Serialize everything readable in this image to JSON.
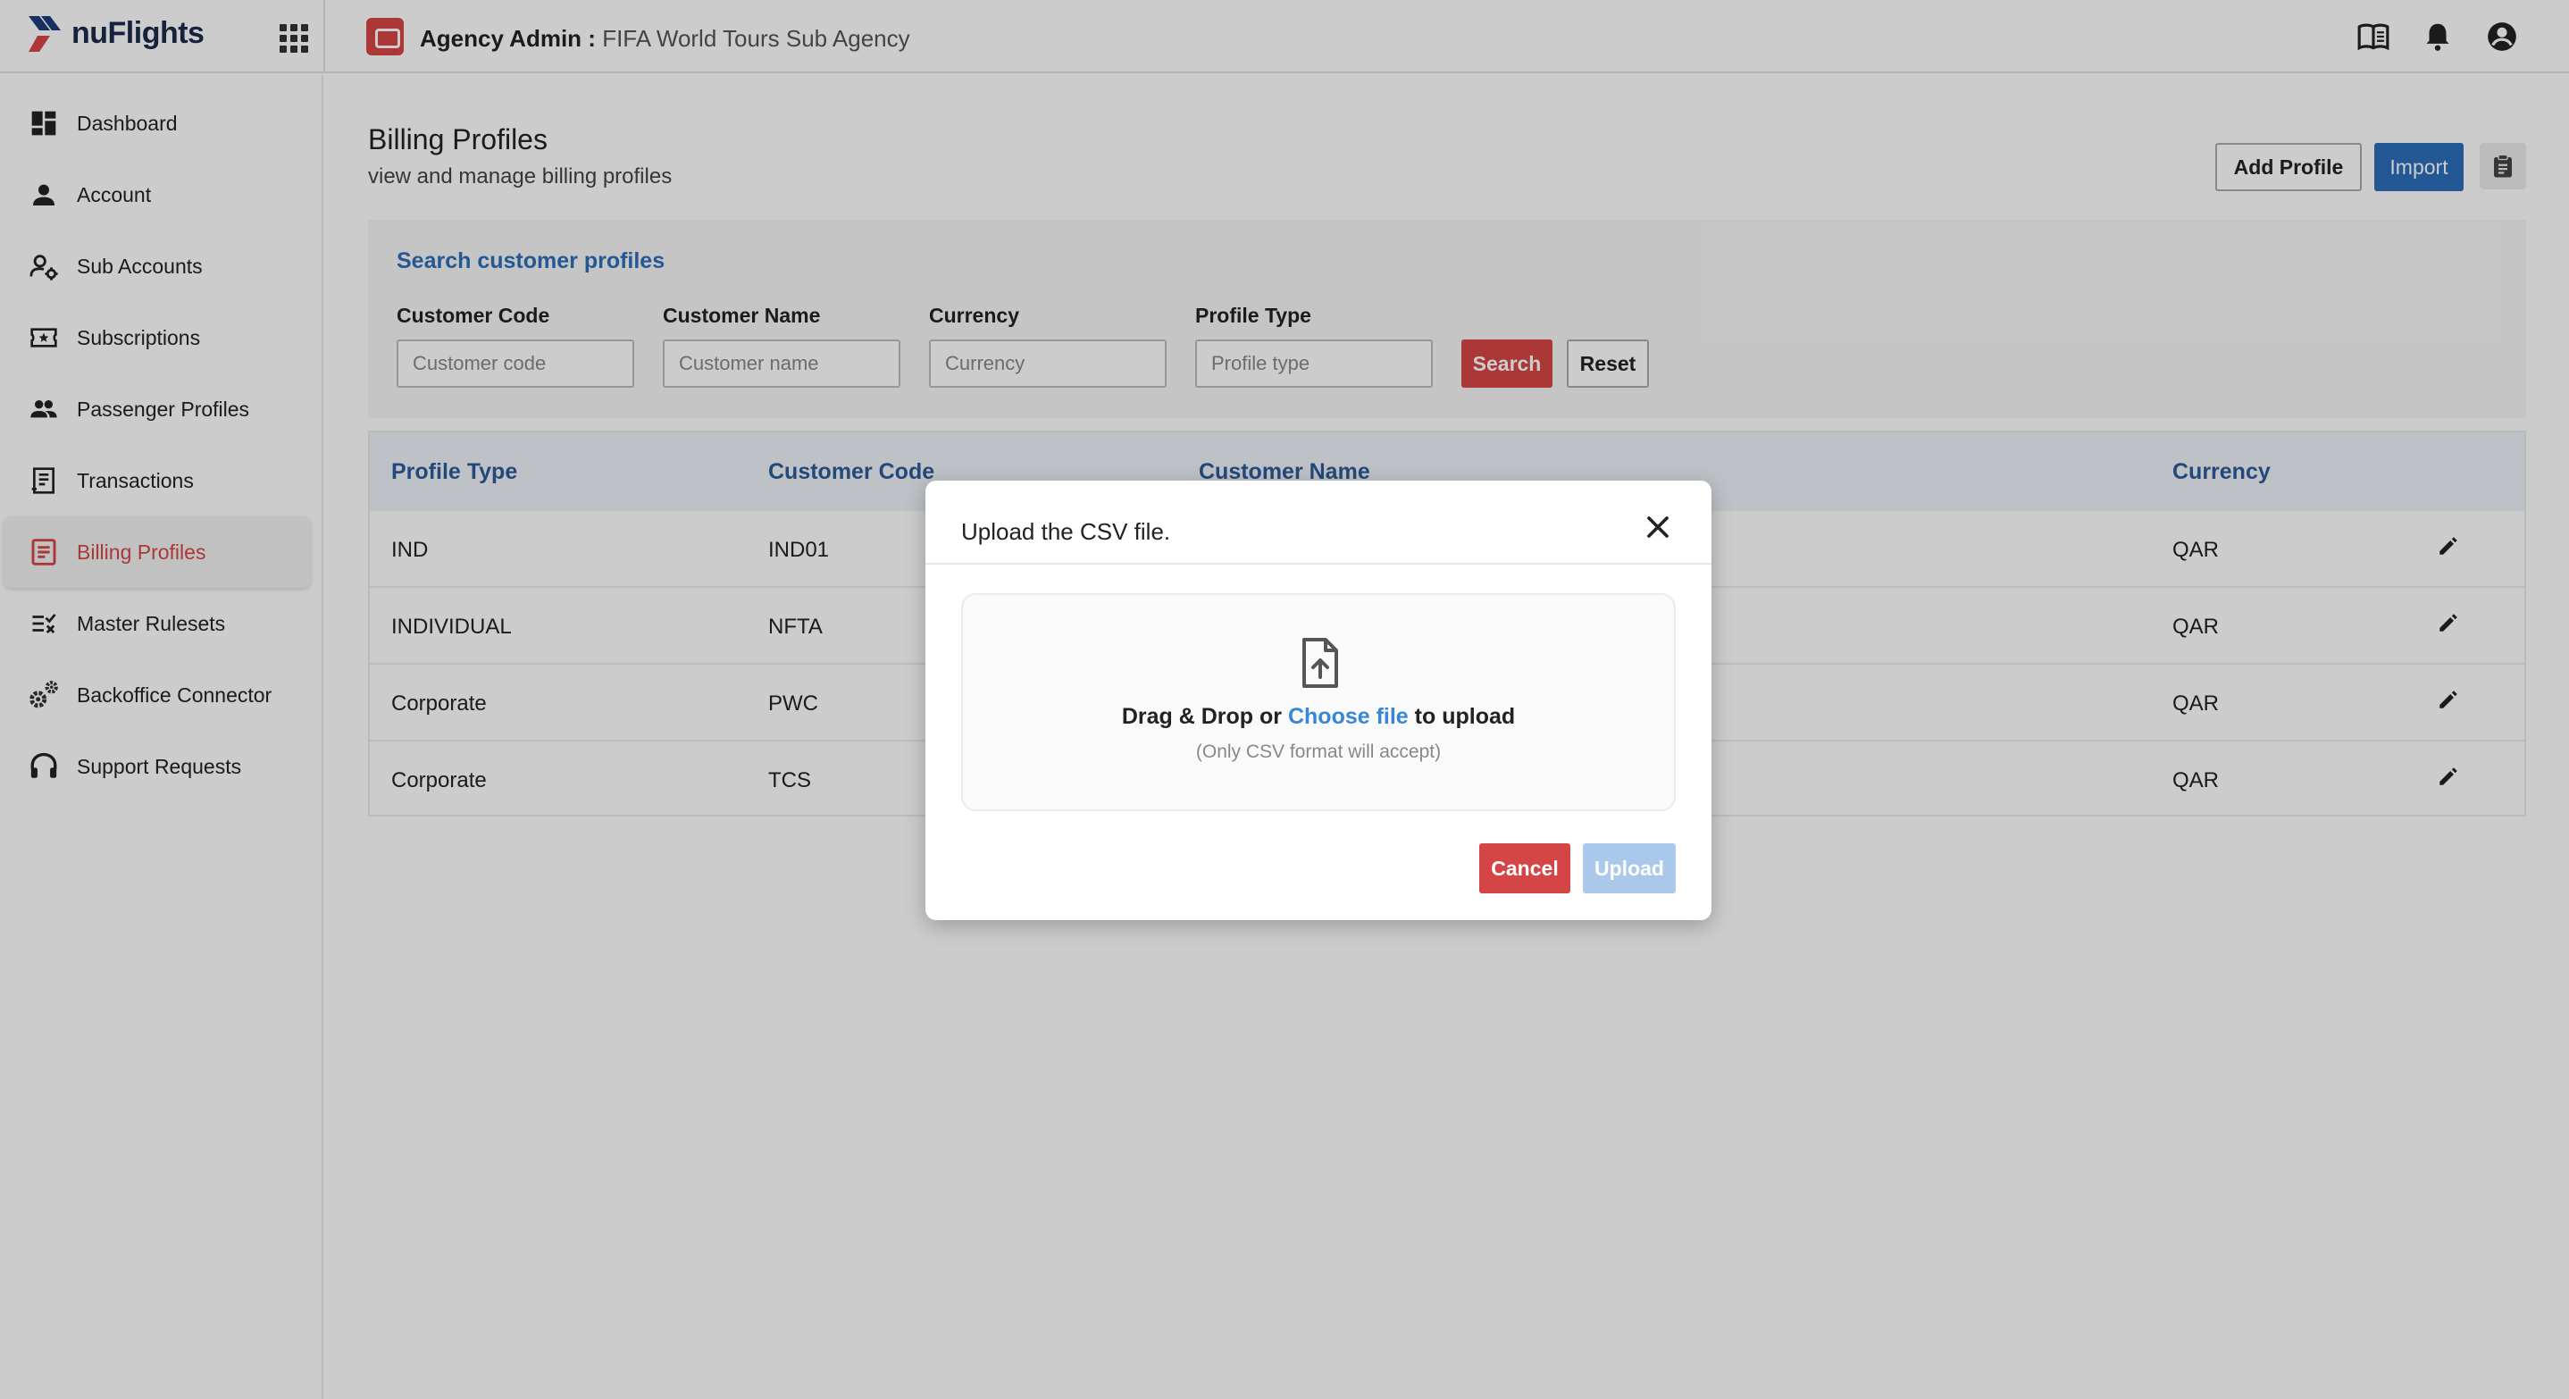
{
  "app": {
    "logo_text": "nuFlights",
    "agency_label": "Agency Admin :",
    "agency_name": "FIFA World Tours Sub Agency"
  },
  "topbar_icons": [
    "book-icon",
    "bell-icon",
    "user-circle-icon"
  ],
  "sidebar": {
    "items": [
      {
        "label": "Dashboard",
        "icon": "dashboard-icon",
        "active": false
      },
      {
        "label": "Account",
        "icon": "person-icon",
        "active": false
      },
      {
        "label": "Sub Accounts",
        "icon": "user-gear-icon",
        "active": false
      },
      {
        "label": "Subscriptions",
        "icon": "ticket-star-icon",
        "active": false
      },
      {
        "label": "Passenger Profiles",
        "icon": "people-icon",
        "active": false
      },
      {
        "label": "Transactions",
        "icon": "receipt-icon",
        "active": false
      },
      {
        "label": "Billing Profiles",
        "icon": "billing-icon",
        "active": true
      },
      {
        "label": "Master Rulesets",
        "icon": "rules-check-icon",
        "active": false
      },
      {
        "label": "Backoffice Connector",
        "icon": "gears-icon",
        "active": false
      },
      {
        "label": "Support Requests",
        "icon": "headset-icon",
        "active": false
      }
    ]
  },
  "page": {
    "title": "Billing Profiles",
    "subtitle": "view and manage billing profiles",
    "add_profile_label": "Add Profile",
    "import_label": "Import"
  },
  "search": {
    "heading": "Search customer profiles",
    "fields": [
      {
        "label": "Customer Code",
        "placeholder": "Customer code"
      },
      {
        "label": "Customer Name",
        "placeholder": "Customer name"
      },
      {
        "label": "Currency",
        "placeholder": "Currency"
      },
      {
        "label": "Profile Type",
        "placeholder": "Profile type"
      }
    ],
    "search_label": "Search",
    "reset_label": "Reset"
  },
  "table": {
    "headers": [
      "Profile Type",
      "Customer Code",
      "Customer Name",
      "Currency"
    ],
    "rows": [
      {
        "profile_type": "IND",
        "customer_code": "IND01",
        "customer_name": "",
        "currency": "QAR"
      },
      {
        "profile_type": "INDIVIDUAL",
        "customer_code": "NFTA",
        "customer_name": "",
        "currency": "QAR"
      },
      {
        "profile_type": "Corporate",
        "customer_code": "PWC",
        "customer_name": "",
        "currency": "QAR"
      },
      {
        "profile_type": "Corporate",
        "customer_code": "TCS",
        "customer_name": "",
        "currency": "QAR"
      }
    ]
  },
  "modal": {
    "title": "Upload the CSV file.",
    "drop_prefix": "Drag & Drop or ",
    "choose_file": "Choose file",
    "drop_suffix": " to upload",
    "hint": "(Only CSV format will accept)",
    "cancel_label": "Cancel",
    "upload_label": "Upload"
  },
  "colors": {
    "brand_red": "#d64545",
    "brand_blue": "#2c6fbb",
    "link_blue": "#3a86d6",
    "disabled_blue": "#a9c8ea"
  }
}
